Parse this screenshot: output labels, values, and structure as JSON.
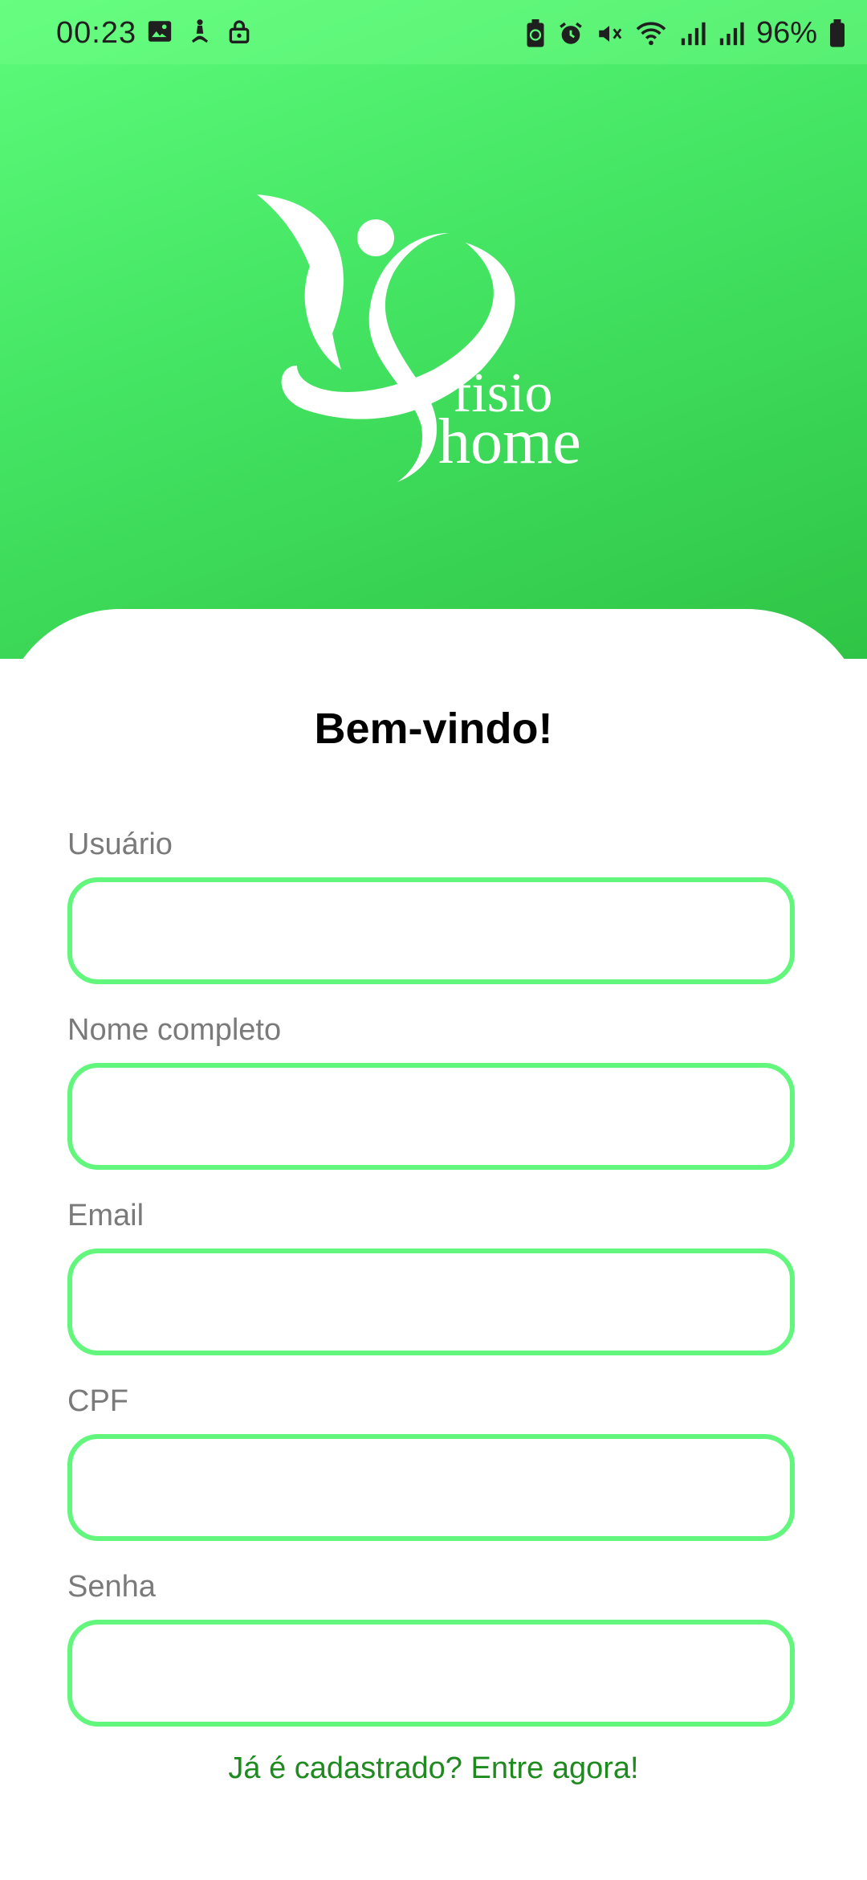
{
  "status_bar": {
    "time": "00:23",
    "battery": "96%",
    "left_icons": [
      "image-icon",
      "accessibility-icon",
      "lock-icon"
    ],
    "right_icons": [
      "battery-saver-icon",
      "alarm-icon",
      "mute-icon",
      "wifi-icon",
      "signal-icon",
      "signal-icon",
      "battery-icon"
    ]
  },
  "logo": {
    "line1": "fisio",
    "line2": "home"
  },
  "form": {
    "title": "Bem-vindo!",
    "fields": [
      {
        "label": "Usuário",
        "value": ""
      },
      {
        "label": "Nome completo",
        "value": ""
      },
      {
        "label": "Email",
        "value": ""
      },
      {
        "label": "CPF",
        "value": ""
      },
      {
        "label": "Senha",
        "value": ""
      }
    ],
    "login_link": "Já é cadastrado? Entre agora!"
  },
  "colors": {
    "accent": "#62f77c",
    "header_top": "#5dfc7b",
    "header_bottom": "#2fc445",
    "link": "#1f8a1f"
  }
}
